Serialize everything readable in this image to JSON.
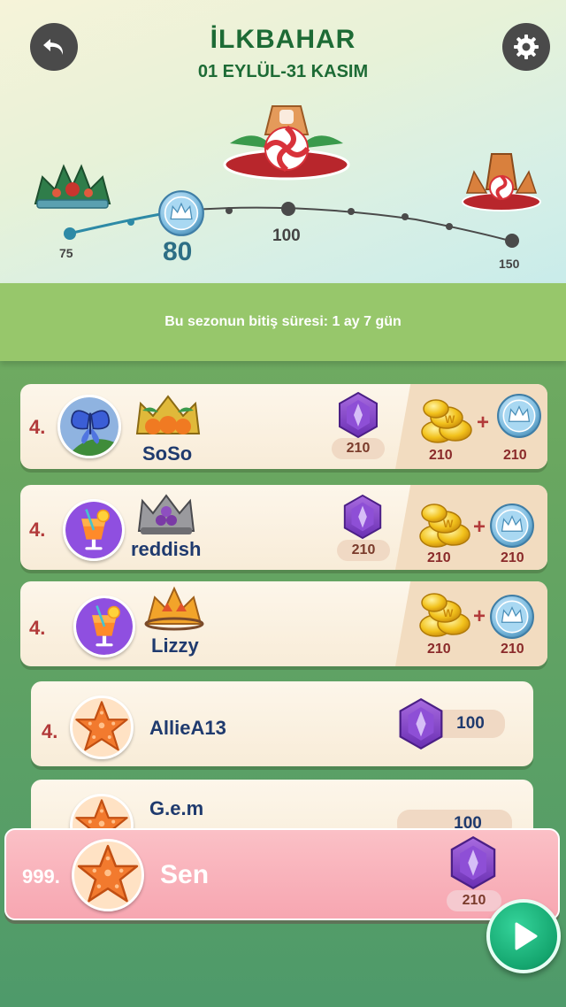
{
  "header": {
    "title": "İLKBAHAR",
    "dates": "01 EYLÜL-31 KASIM",
    "back_icon": "undo-arrow-icon",
    "settings_icon": "gear-icon",
    "progress": {
      "current": "80",
      "milestones": [
        "75",
        "100",
        "150"
      ]
    }
  },
  "banner": {
    "text": "Bu sezonun bitiş süresi: 1 ay 7 gün"
  },
  "leaderboard": [
    {
      "rank": "4.",
      "name": "SoSo",
      "score": "210",
      "reward_coins": "210",
      "reward_crowns": "210",
      "avatar": "butterfly",
      "crown": "pumpkin-crown"
    },
    {
      "rank": "4.",
      "name": "reddish",
      "score": "210",
      "reward_coins": "210",
      "reward_crowns": "210",
      "avatar": "cocktail",
      "crown": "grape-crown"
    },
    {
      "rank": "4.",
      "name": "Lizzy",
      "score": "",
      "reward_coins": "210",
      "reward_crowns": "210",
      "avatar": "cocktail",
      "crown": "autumn-leaf-crown"
    },
    {
      "rank": "4.",
      "name": "AllieA13",
      "score": "100",
      "avatar": "starfish"
    },
    {
      "rank": "",
      "name": "G.e.m",
      "score": "100",
      "avatar": "starfish"
    }
  ],
  "me": {
    "rank": "999.",
    "name": "Sen",
    "score": "210",
    "avatar": "starfish"
  },
  "colors": {
    "accent_green": "#1d6b35",
    "rank_red": "#b23a3a",
    "name_blue": "#1f3a6e",
    "me_row_pink": "#f7a6b1",
    "play_green": "#14a56e"
  }
}
